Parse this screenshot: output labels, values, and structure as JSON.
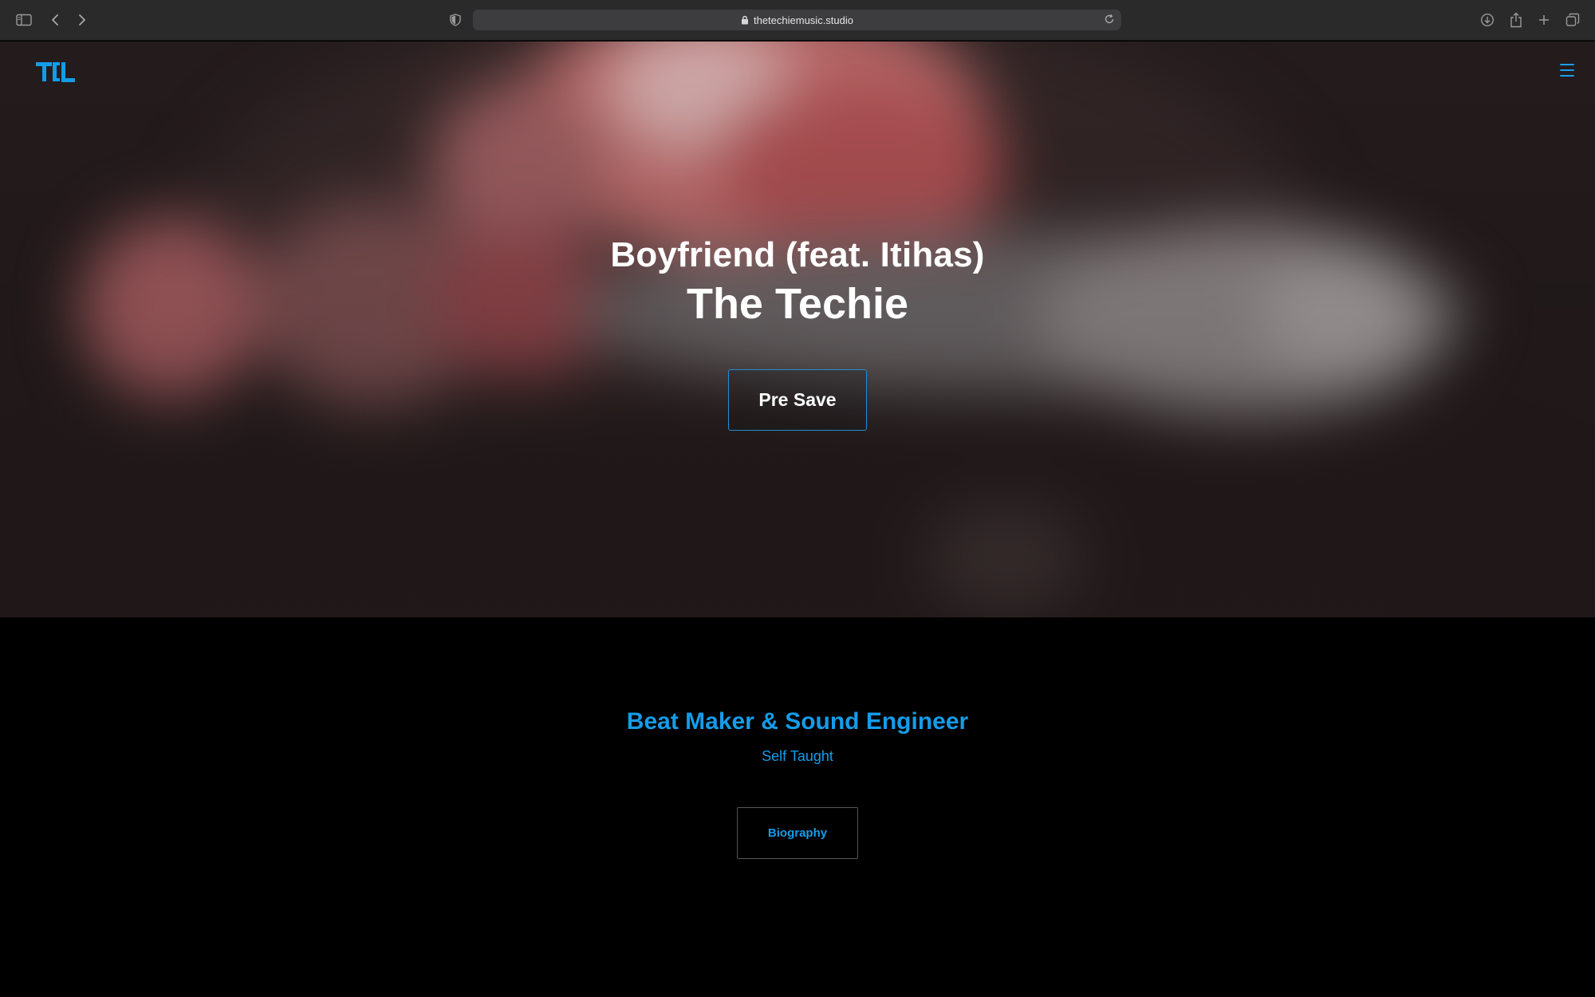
{
  "browser": {
    "url": "thetechiemusic.studio",
    "icons": [
      "sidebar-icon",
      "back-icon",
      "forward-icon",
      "privacy-shield-icon",
      "lock-icon",
      "reload-icon",
      "download-icon",
      "share-icon",
      "new-tab-icon",
      "tab-overview-icon"
    ]
  },
  "site": {
    "logo_text": "TT",
    "accent_color": "#159ce8"
  },
  "hero": {
    "track_title": "Boyfriend (feat. Itihas)",
    "artist": "The Techie",
    "cta_label": "Pre Save"
  },
  "bio": {
    "heading": "Beat Maker & Sound Engineer",
    "subheading": "Self Taught",
    "button_label": "Biography"
  }
}
